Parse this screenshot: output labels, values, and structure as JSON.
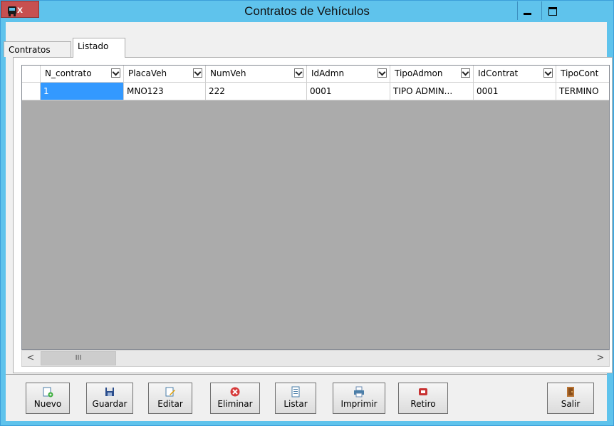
{
  "window": {
    "title": "Contratos de Vehículos",
    "close_label": "x"
  },
  "tabs": [
    {
      "label": "Contratos",
      "active": false
    },
    {
      "label": "Listado",
      "active": true
    }
  ],
  "grid": {
    "columns": [
      "N_contrato",
      "PlacaVeh",
      "NumVeh",
      "IdAdmn",
      "TipoAdmon",
      "IdContrat",
      "TipoCont"
    ],
    "rows": [
      [
        "1",
        "MNO123",
        "222",
        "0001",
        "TIPO ADMIN...",
        "0001",
        "TERMINO"
      ]
    ],
    "selected_row": 0
  },
  "scrollbar": {
    "left_arrow": "<",
    "right_arrow": ">",
    "thumb_glyph": "III"
  },
  "toolbar": {
    "nuevo": "Nuevo",
    "guardar": "Guardar",
    "editar": "Editar",
    "eliminar": "Eliminar",
    "listar": "Listar",
    "imprimir": "Imprimir",
    "retiro": "Retiro",
    "salir": "Salir"
  },
  "colors": {
    "titlebar": "#5fc3ec",
    "grid_background": "#ababab",
    "selection": "#3399ff",
    "close_button": "#c75050"
  },
  "icons": {
    "app": "bus-icon",
    "nuevo": "new-document-icon",
    "guardar": "floppy-disk-icon",
    "editar": "edit-document-icon",
    "eliminar": "delete-icon",
    "listar": "list-icon",
    "imprimir": "printer-icon",
    "retiro": "retire-icon",
    "salir": "exit-door-icon"
  }
}
